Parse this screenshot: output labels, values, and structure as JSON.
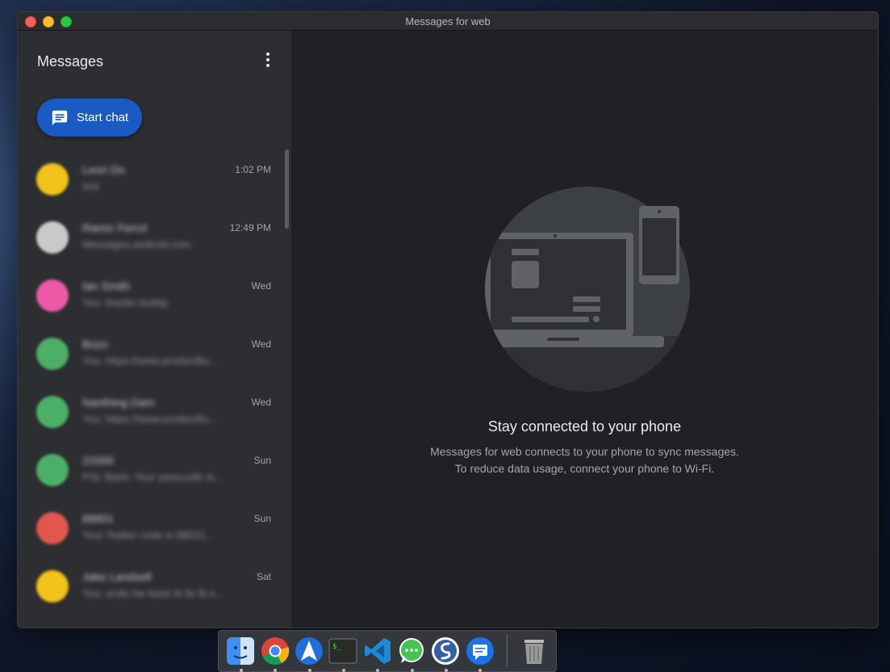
{
  "window": {
    "title": "Messages for web"
  },
  "sidebar": {
    "title": "Messages",
    "more_icon": "more-vert-icon",
    "start_chat": {
      "label": "Start chat",
      "icon": "chat-icon"
    },
    "conversations": [
      {
        "name": "Leon Do",
        "snippet": "test",
        "time": "1:02 PM",
        "avatar_color": "#f3c21b"
      },
      {
        "name": "Ramiz Ferrol",
        "snippet": "Messages.android.com",
        "time": "12:49 PM",
        "avatar_color": "#c9c9c9"
      },
      {
        "name": "Ian Smith",
        "snippet": "You: thanks buddy",
        "time": "Wed",
        "avatar_color": "#ee5aa8"
      },
      {
        "name": "Bozo",
        "snippet": "You: https://www.productfiu...",
        "time": "Wed",
        "avatar_color": "#4caf68"
      },
      {
        "name": "Nanthing Dam",
        "snippet": "You: https://www.productfiu...",
        "time": "Wed",
        "avatar_color": "#4caf68"
      },
      {
        "name": "22000",
        "snippet": "PSL Bank: Your passcode is...",
        "time": "Sun",
        "avatar_color": "#4caf68"
      },
      {
        "name": "88801",
        "snippet": "Your Twitter code is 88021...",
        "time": "Sun",
        "avatar_color": "#e0574b"
      },
      {
        "name": "Jake Landsell",
        "snippet": "You: undo hw base tk fw lb e...",
        "time": "Sat",
        "avatar_color": "#f3c21b"
      }
    ]
  },
  "main": {
    "illustration_icon": "laptop-phone-illustration",
    "title": "Stay connected to your phone",
    "description_line1": "Messages for web connects to your phone to sync messages.",
    "description_line2": "To reduce data usage, connect your phone to Wi-Fi."
  },
  "dock": {
    "apps": [
      "finder-icon",
      "chrome-icon",
      "spark-icon",
      "terminal-icon",
      "vscode-icon",
      "whatsapp-icon",
      "simplenote-icon",
      "messages-icon"
    ],
    "trash": "trash-icon"
  },
  "colors": {
    "accent": "#1a5bc3",
    "sidebar_bg": "#2d2e31",
    "main_bg": "#202124"
  }
}
